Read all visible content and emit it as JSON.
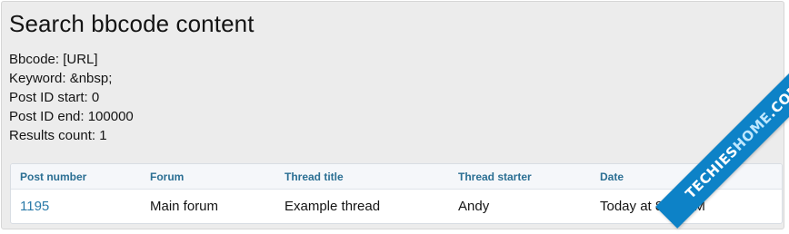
{
  "page": {
    "title": "Search bbcode content"
  },
  "search_info": {
    "bbcode": "Bbcode: [URL]",
    "keyword": "Keyword: &nbsp;",
    "post_id_start": "Post ID start: 0",
    "post_id_end": "Post ID end: 100000",
    "results_count": "Results count: 1"
  },
  "table": {
    "columns": [
      "Post number",
      "Forum",
      "Thread title",
      "Thread starter",
      "Date"
    ],
    "rows": [
      {
        "post_number": "1195",
        "forum": "Main forum",
        "thread_title": "Example thread",
        "thread_starter": "Andy",
        "date": "Today at 8:00 AM"
      }
    ]
  },
  "watermark": {
    "text_part1": "TECHIES",
    "text_part2": "HOME",
    "text_part3": ".COM"
  },
  "colors": {
    "header_text": "#2b6f93",
    "link": "#2b7aa8",
    "panel_bg": "#ececec",
    "ribbon_bg": "#0d82c7"
  }
}
